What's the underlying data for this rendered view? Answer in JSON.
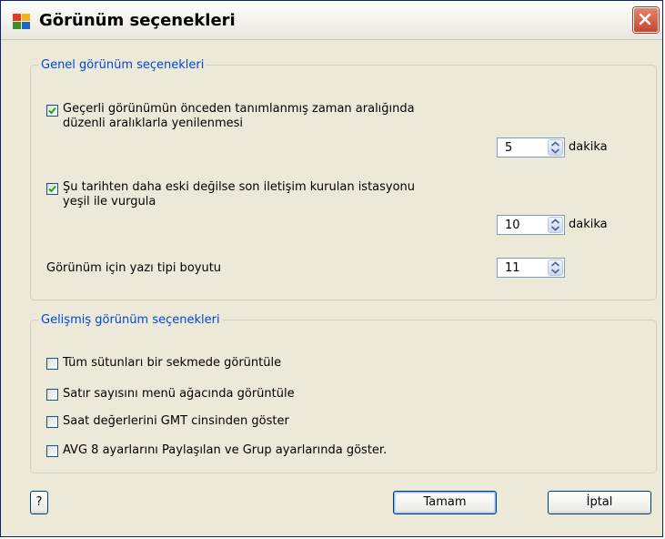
{
  "window": {
    "title": "Görünüm seçenekleri"
  },
  "general": {
    "legend": "Genel görünüm seçenekleri",
    "refresh": {
      "line1": "Geçerli görünümün önceden tanımlanmış zaman aralığında",
      "line2": "düzenli aralıklarla yenilenmesi",
      "checked": true,
      "value": "5",
      "unit": "dakika"
    },
    "highlight": {
      "line1": "Şu tarihten daha eski değilse son iletişim kurulan istasyonu",
      "line2": "yeşil ile vurgula",
      "checked": true,
      "value": "10",
      "unit": "dakika"
    },
    "font_size": {
      "label": "Görünüm için yazı tipi boyutu",
      "value": "11"
    }
  },
  "advanced": {
    "legend": "Gelişmiş görünüm seçenekleri",
    "options": [
      {
        "label": "Tüm sütunları bir sekmede görüntüle",
        "checked": false
      },
      {
        "label": "Satır sayısını menü ağacında görüntüle",
        "checked": false
      },
      {
        "label": "Saat değerlerini GMT cinsinden göster",
        "checked": false
      },
      {
        "label": "AVG 8 ayarlarını Paylaşılan ve Grup ayarlarında göster.",
        "checked": false
      }
    ]
  },
  "buttons": {
    "help": "?",
    "ok": "Tamam",
    "cancel": "İptal"
  },
  "colors": {
    "legend": "#0046d5",
    "checkmark": "#21a121",
    "close": "#c8462e"
  }
}
